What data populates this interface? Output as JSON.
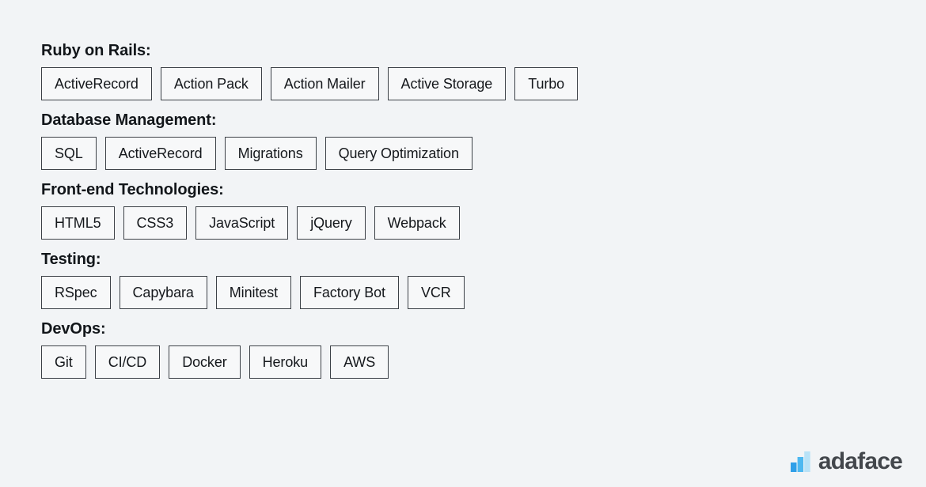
{
  "page": {
    "background_color": "#f2f4f6",
    "text_color": "#15181c"
  },
  "sections": [
    {
      "heading": "Ruby on Rails:",
      "chips": [
        "ActiveRecord",
        "Action Pack",
        "Action Mailer",
        "Active Storage",
        "Turbo"
      ]
    },
    {
      "heading": "Database Management:",
      "chips": [
        "SQL",
        "ActiveRecord",
        "Migrations",
        "Query Optimization"
      ]
    },
    {
      "heading": "Front-end Technologies:",
      "chips": [
        "HTML5",
        "CSS3",
        "JavaScript",
        "jQuery",
        "Webpack"
      ]
    },
    {
      "heading": "Testing:",
      "chips": [
        "RSpec",
        "Capybara",
        "Minitest",
        "Factory Bot",
        "VCR"
      ]
    },
    {
      "heading": "DevOps:",
      "chips": [
        "Git",
        "CI/CD",
        "Docker",
        "Heroku",
        "AWS"
      ]
    }
  ],
  "brand": {
    "name": "adaface",
    "icon": "bar-chart-logo-icon",
    "bar_colors": [
      "#2f9fe8",
      "#4db8f0",
      "#b8e2f7"
    ],
    "word_color": "#43474c"
  }
}
